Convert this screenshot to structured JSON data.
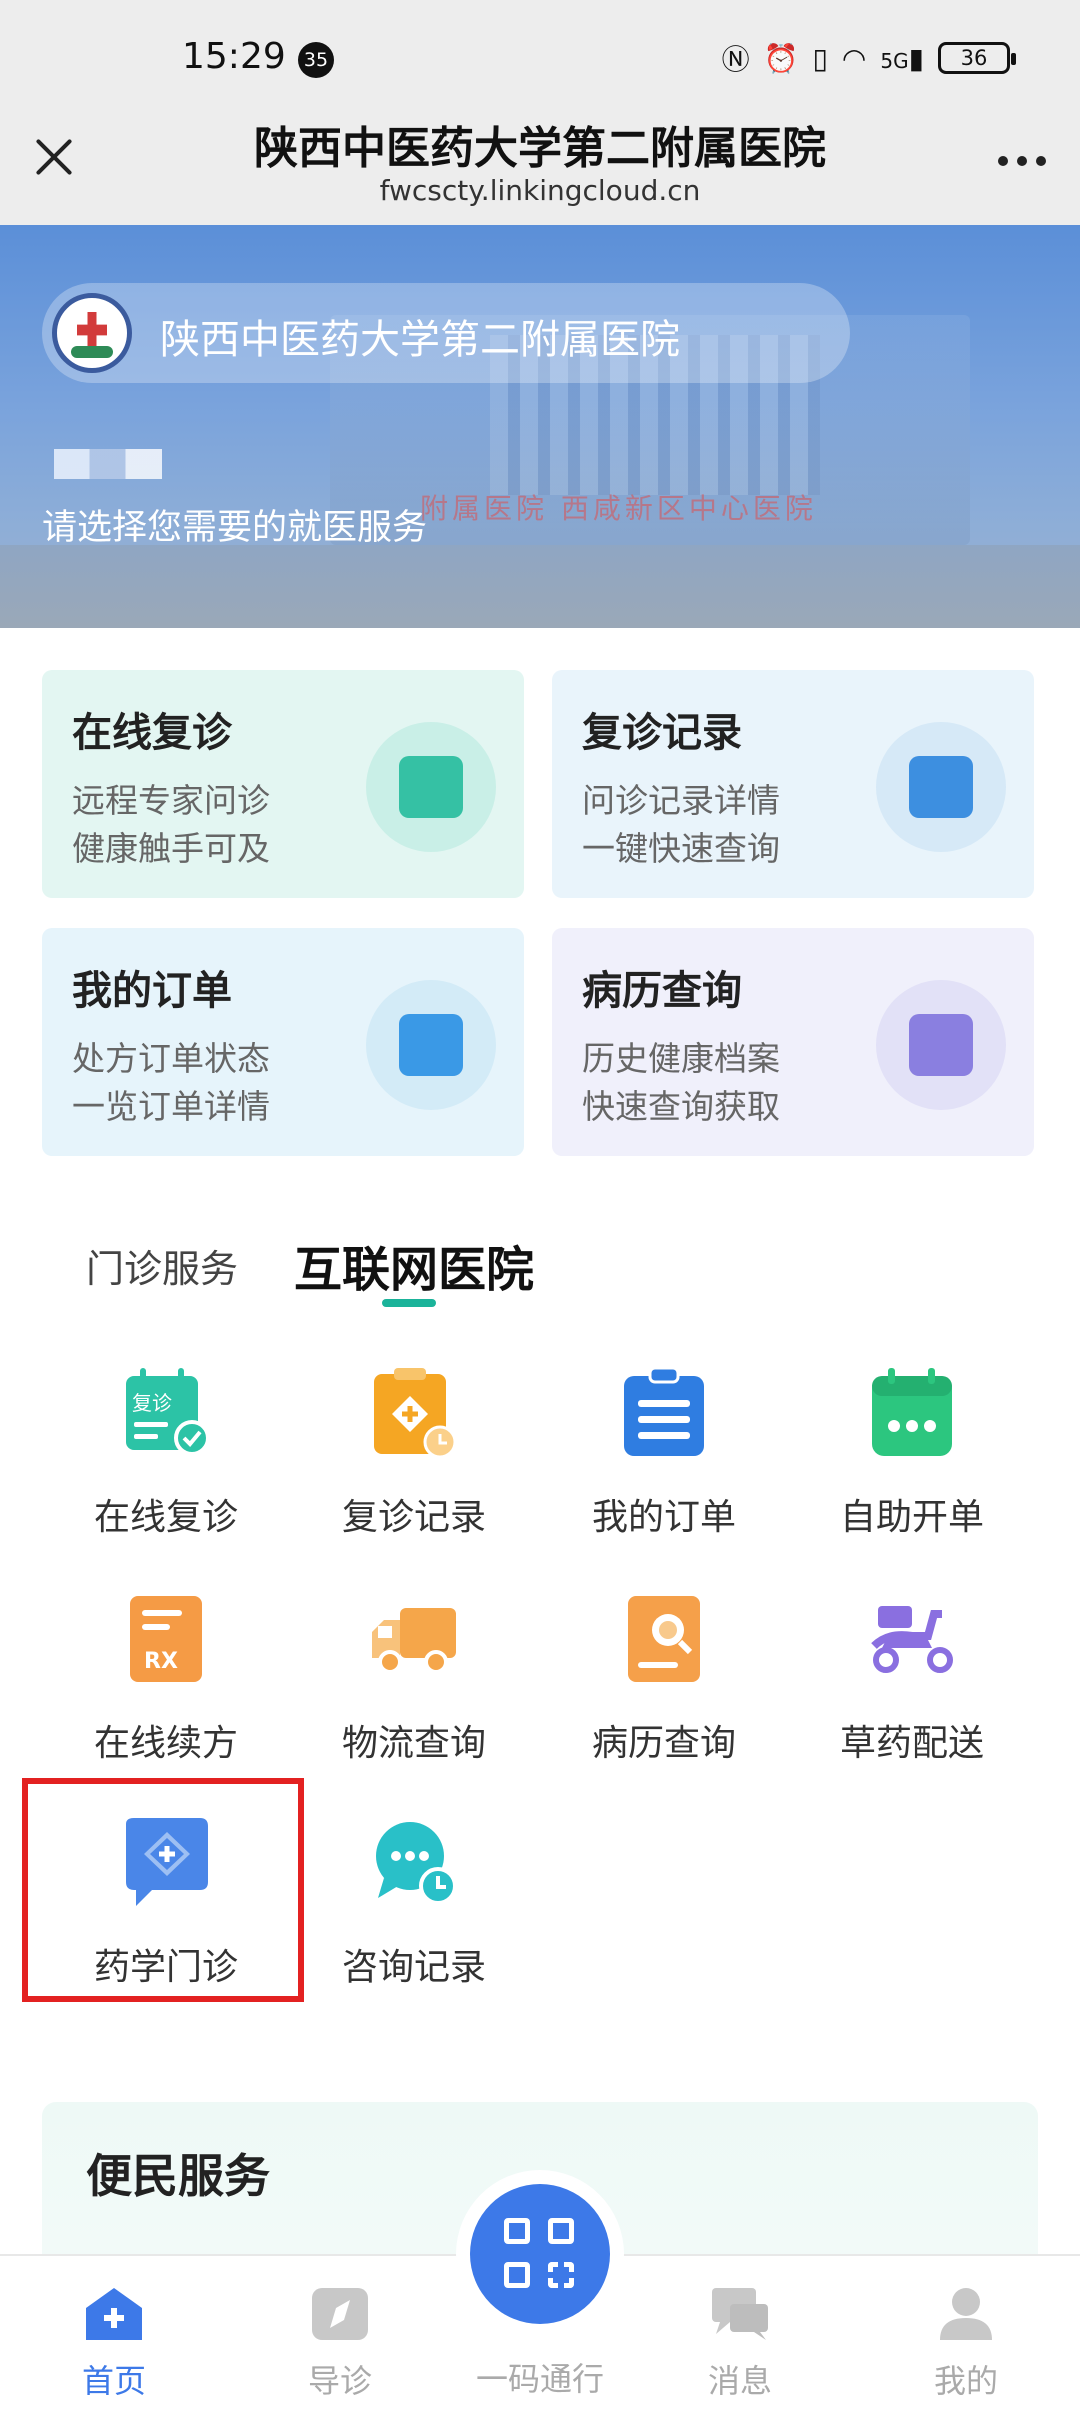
{
  "status_bar": {
    "time": "15:29",
    "notification_count": "35",
    "network": "5G",
    "battery": "36"
  },
  "title_bar": {
    "title": "陕西中医药大学第二附属医院",
    "url": "fwcscty.linkingcloud.cn"
  },
  "banner": {
    "hospital_name": "陕西中医药大学第二附属医院",
    "subtitle": "请选择您需要的就医服务",
    "sign_text": "附属医院  西咸新区中心医院"
  },
  "cards": [
    {
      "title": "在线复诊",
      "line1": "远程专家问诊",
      "line2": "健康触手可及",
      "icon": "video-consult-icon",
      "bg": "#e3f6f2",
      "icon_bg": "#c9efe7",
      "icon_color": "#35c1a4"
    },
    {
      "title": "复诊记录",
      "line1": "问诊记录详情",
      "line2": "一键快速查询",
      "icon": "stethoscope-record-icon",
      "bg": "#e9f4fb",
      "icon_bg": "#d6e9f7",
      "icon_color": "#3d8fe0"
    },
    {
      "title": "我的订单",
      "line1": "处方订单状态",
      "line2": "一览订单详情",
      "icon": "checklist-icon",
      "bg": "#e6f4fb",
      "icon_bg": "#d3ebf7",
      "icon_color": "#3a99e6"
    },
    {
      "title": "病历查询",
      "line1": "历史健康档案",
      "line2": "快速查询获取",
      "icon": "medical-record-icon",
      "bg": "#f0f0fb",
      "icon_bg": "#e2e1f7",
      "icon_color": "#8a7fe0"
    }
  ],
  "tabs": [
    {
      "label": "门诊服务",
      "active": false
    },
    {
      "label": "互联网医院",
      "active": true
    }
  ],
  "services": [
    {
      "label": "在线复诊",
      "icon": "revisit-calendar-icon",
      "color": "#2cc3a6",
      "badge": "复诊"
    },
    {
      "label": "复诊记录",
      "icon": "clipboard-clock-icon",
      "color": "#f5a623"
    },
    {
      "label": "我的订单",
      "icon": "clipboard-list-icon",
      "color": "#2f7de1"
    },
    {
      "label": "自助开单",
      "icon": "calendar-icon",
      "color": "#2cc67f"
    },
    {
      "label": "在线续方",
      "icon": "rx-document-icon",
      "color": "#f59b45",
      "badge": "RX"
    },
    {
      "label": "物流查询",
      "icon": "truck-icon",
      "color": "#f5a64a"
    },
    {
      "label": "病历查询",
      "icon": "document-search-icon",
      "color": "#f5a04a"
    },
    {
      "label": "草药配送",
      "icon": "scooter-icon",
      "color": "#8a6fe0"
    },
    {
      "label": "药学门诊",
      "icon": "diamond-plus-chat-icon",
      "color": "#4a86e8"
    },
    {
      "label": "咨询记录",
      "icon": "chat-clock-icon",
      "color": "#29c0c8"
    }
  ],
  "convenience": {
    "title": "便民服务"
  },
  "bottom_nav": [
    {
      "label": "首页",
      "icon": "home-plus-icon",
      "active": true,
      "active_color": "#3d79e8"
    },
    {
      "label": "导诊",
      "icon": "compass-icon",
      "active": false
    },
    {
      "label": "一码通行",
      "icon": "qr-code-icon",
      "active": false
    },
    {
      "label": "消息",
      "icon": "message-icon",
      "active": false
    },
    {
      "label": "我的",
      "icon": "user-icon",
      "active": false
    }
  ]
}
